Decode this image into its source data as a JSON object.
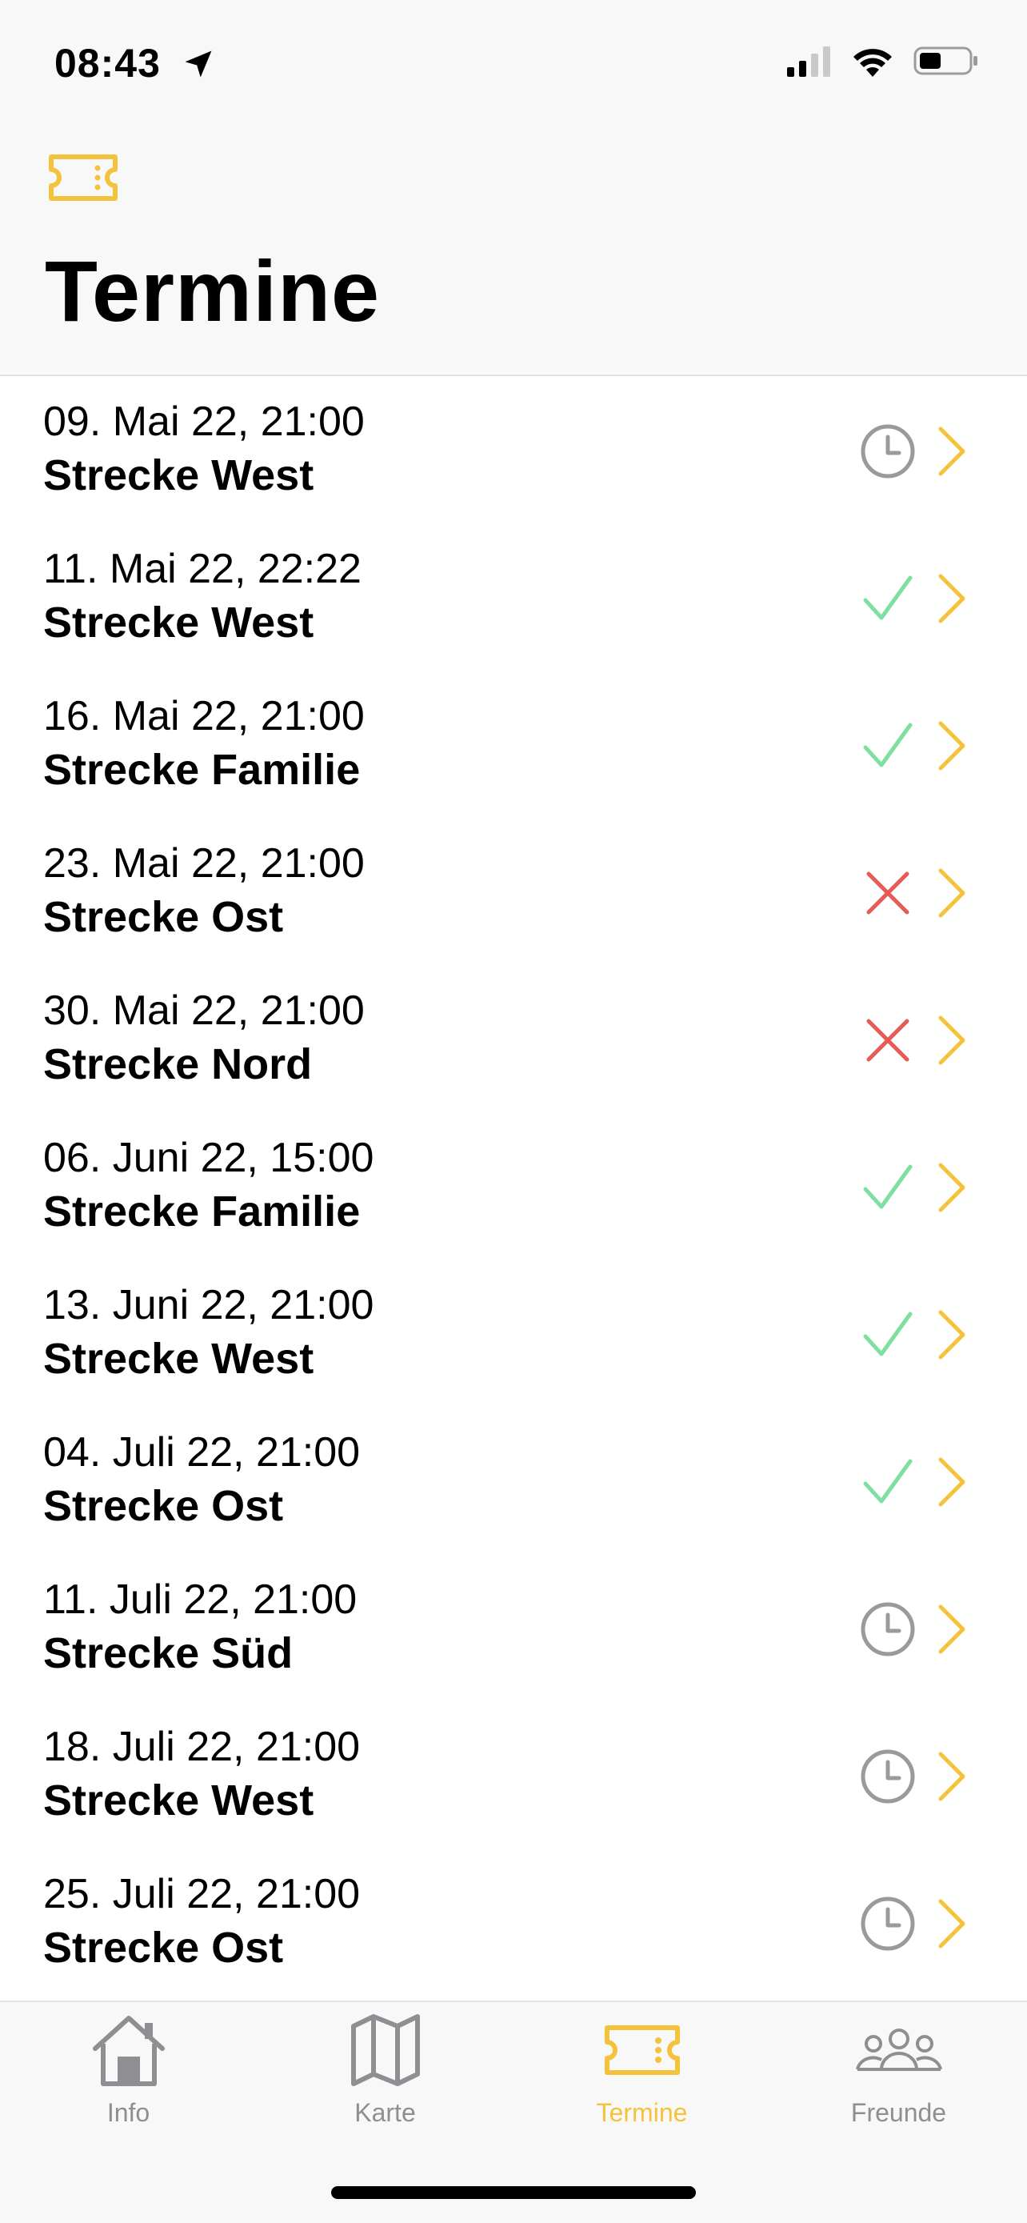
{
  "status_bar": {
    "time": "08:43",
    "location_icon": "location-arrow-icon",
    "signal_icon": "cellular-signal-icon",
    "wifi_icon": "wifi-icon",
    "battery_icon": "battery-icon"
  },
  "header": {
    "icon": "ticket-icon",
    "title": "Termine"
  },
  "colors": {
    "accent": "#f4c33b",
    "check": "#7ee0a0",
    "cross": "#e85a55",
    "pending": "#9a9a9a"
  },
  "appointments": [
    {
      "date": "09. Mai 22, 21:00",
      "route": "Strecke West",
      "status": "pending"
    },
    {
      "date": "11. Mai 22, 22:22",
      "route": "Strecke West",
      "status": "done"
    },
    {
      "date": "16. Mai 22, 21:00",
      "route": "Strecke Familie",
      "status": "done"
    },
    {
      "date": "23. Mai 22, 21:00",
      "route": "Strecke Ost",
      "status": "cancelled"
    },
    {
      "date": "30. Mai 22, 21:00",
      "route": "Strecke Nord",
      "status": "cancelled"
    },
    {
      "date": "06. Juni 22, 15:00",
      "route": "Strecke Familie",
      "status": "done"
    },
    {
      "date": "13. Juni 22, 21:00",
      "route": "Strecke West",
      "status": "done"
    },
    {
      "date": "04. Juli 22, 21:00",
      "route": "Strecke Ost",
      "status": "done"
    },
    {
      "date": "11. Juli 22, 21:00",
      "route": "Strecke Süd",
      "status": "pending"
    },
    {
      "date": "18. Juli 22, 21:00",
      "route": "Strecke West",
      "status": "pending"
    },
    {
      "date": "25. Juli 22, 21:00",
      "route": "Strecke Ost",
      "status": "pending"
    }
  ],
  "tabbar": {
    "tabs": [
      {
        "label": "Info",
        "icon": "house-icon",
        "active": false
      },
      {
        "label": "Karte",
        "icon": "map-icon",
        "active": false
      },
      {
        "label": "Termine",
        "icon": "ticket-icon",
        "active": true
      },
      {
        "label": "Freunde",
        "icon": "friends-icon",
        "active": false
      }
    ]
  }
}
